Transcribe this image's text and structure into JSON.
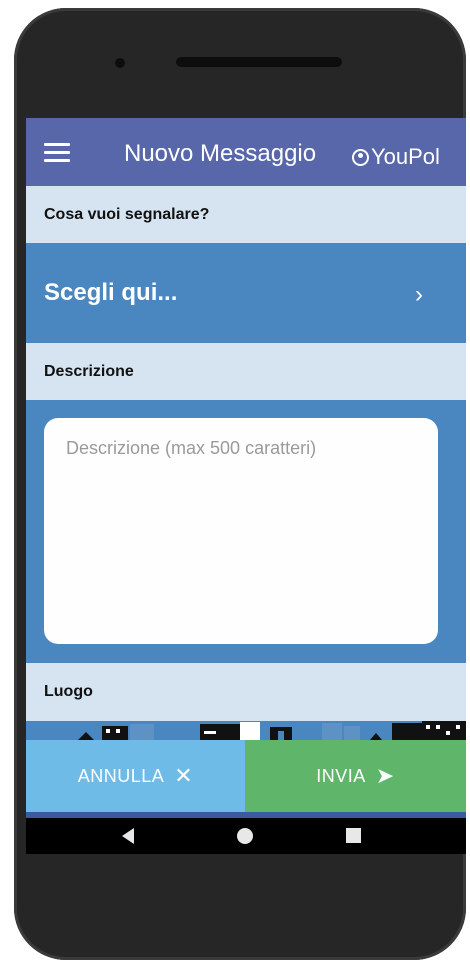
{
  "app": {
    "title": "Nuovo Messaggio",
    "brand": "YouPol"
  },
  "form": {
    "report_label": "Cosa vuoi segnalare?",
    "choose_label": "Scegli qui...",
    "chevron": "›",
    "description_label": "Descrizione",
    "description_placeholder": "Descrizione (max 500 caratteri)",
    "description_value": "",
    "location_label": "Luogo"
  },
  "actions": {
    "cancel_label": "ANNULLA",
    "cancel_icon": "✕",
    "send_label": "INVIA",
    "send_icon": "➤"
  },
  "colors": {
    "app_bar": "#5767a9",
    "section_bg": "#d6e4f1",
    "panel_bg": "#4a86bf",
    "cancel_bg": "#6fbbe8",
    "send_bg": "#5fb66b"
  },
  "icons": {
    "menu": "hamburger-menu-icon",
    "brand": "user-circle-icon",
    "chevron": "chevron-right-icon",
    "cancel": "close-icon",
    "send": "send-arrow-icon",
    "nav_back": "back-triangle-icon",
    "nav_home": "home-circle-icon",
    "nav_recent": "recents-square-icon"
  }
}
